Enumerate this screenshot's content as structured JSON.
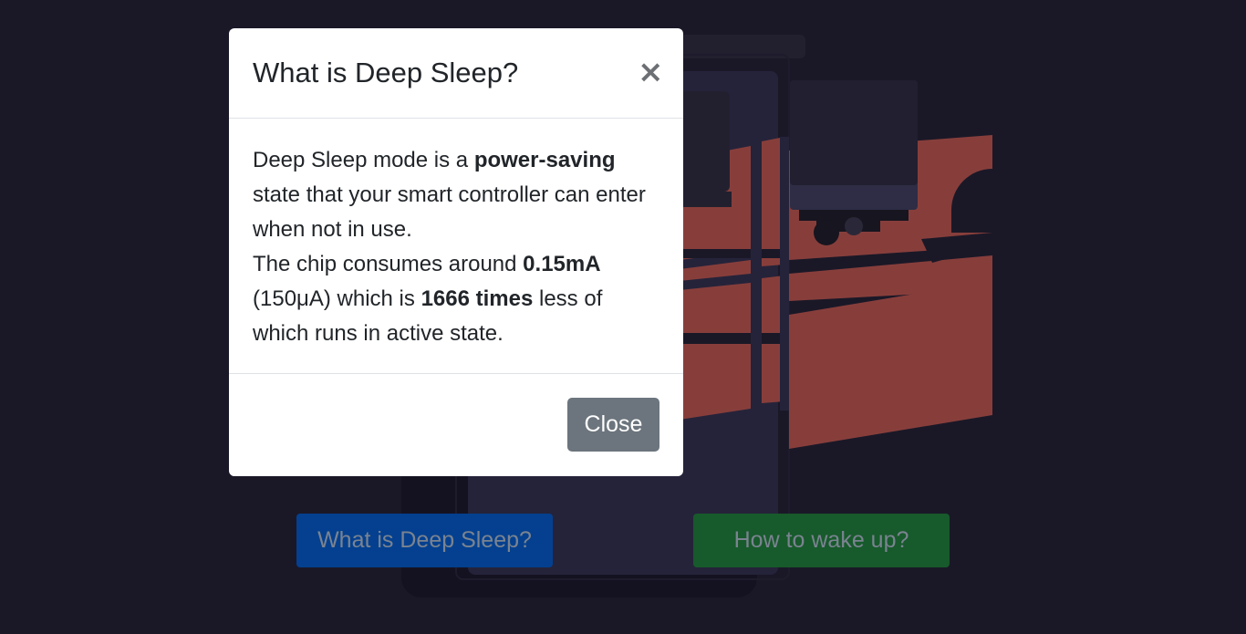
{
  "page": {
    "buttons": {
      "deep_sleep_label": "What is Deep Sleep?",
      "wake_up_label": "How to wake up?"
    }
  },
  "modal": {
    "title": "What is Deep Sleep?",
    "close_icon": "close-icon",
    "close_symbol": "×",
    "body": {
      "line1_pre": "Deep Sleep mode is a ",
      "line1_bold": "power-saving",
      "line1_post": " state that your smart controller can enter when not in use.",
      "line2_pre": "The chip consumes around ",
      "line2_bold1": "0.15mA",
      "line2_mid": " (150μA) which is ",
      "line2_bold2": "1666 times",
      "line2_post": " less of which runs in active state."
    },
    "footer": {
      "close_label": "Close"
    }
  },
  "colors": {
    "background": "#1a1827",
    "primary_button": "#04408f",
    "success_button": "#175a2b",
    "secondary_button": "#6c757d",
    "illustration_red": "#873e3b"
  }
}
